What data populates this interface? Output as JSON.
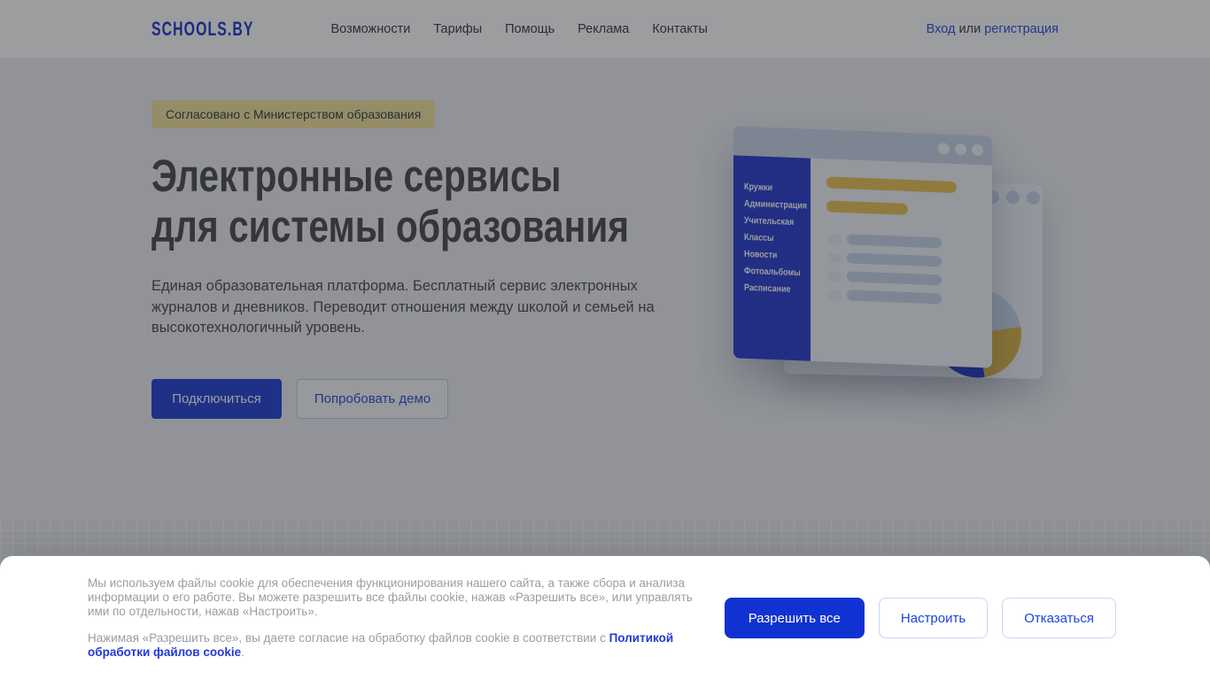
{
  "header": {
    "logo": "SCHOOLS.BY",
    "nav": [
      "Возможности",
      "Тарифы",
      "Помощь",
      "Реклама",
      "Контакты"
    ],
    "auth": {
      "login": "Вход",
      "separator": " или ",
      "register": "регистрация"
    }
  },
  "hero": {
    "badge": "Согласовано с Министерством образования",
    "title_line1": "Электронные сервисы",
    "title_line2": "для системы образования",
    "description": "Единая образовательная платформа. Бесплатный сервис электронных журналов и дневников. Переводит отношения между школой и семьей на высокотехнологичный уровень.",
    "primary_button": "Подключиться",
    "secondary_button": "Попробовать демо"
  },
  "illustration": {
    "sidebar_items": [
      "Кружки",
      "Администрация",
      "Учительская",
      "Классы",
      "Новости",
      "Фотоальбомы",
      "Расписание"
    ]
  },
  "cookie_banner": {
    "paragraph1": "Мы используем файлы cookie для обеспечения функционирования нашего сайта, а также сбора и анализа информации о его работе. Вы можете разрешить все файлы cookie, нажав «Разрешить все», или управлять ими по отдельности, нажав «Настроить».",
    "paragraph2_prefix": "Нажимая «Разрешить все», вы даете согласие на обработку файлов cookie в соответствии с ",
    "policy_link": "Политикой обработки файлов cookie",
    "paragraph2_suffix": ".",
    "allow_button": "Разрешить все",
    "configure_button": "Настроить",
    "decline_button": "Отказаться"
  },
  "colors": {
    "brand_blue": "#2F4BD7",
    "button_blue": "#1132D2",
    "accent_yellow": "#E9C75F",
    "badge_yellow": "#F2E5A4",
    "sidebar_blue": "#3347D2"
  }
}
